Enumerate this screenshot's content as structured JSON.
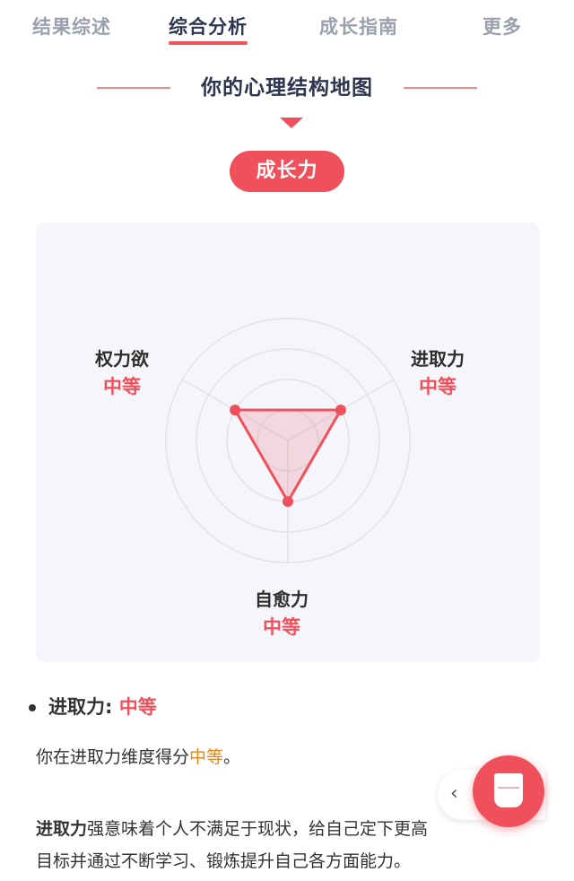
{
  "tabs": [
    {
      "label": "结果综述",
      "active": false
    },
    {
      "label": "综合分析",
      "active": true
    },
    {
      "label": "成长指南",
      "active": false
    },
    {
      "label": "更多",
      "active": false
    }
  ],
  "section": {
    "title": "你的心理结构地图",
    "pill": "成长力"
  },
  "radar": {
    "axes": [
      {
        "name": "权力欲",
        "level": "中等"
      },
      {
        "name": "进取力",
        "level": "中等"
      },
      {
        "name": "自愈力",
        "level": "中等"
      }
    ],
    "values": [
      0.5,
      0.5,
      0.5
    ]
  },
  "detail": {
    "bullet_label": "进取力:",
    "bullet_value": "中等",
    "line1_prefix": "你在进取力维度得分",
    "line1_value": "中等",
    "line1_suffix": "。",
    "line2_bold": "进取力",
    "line2_rest": "强意味着个人不满足于现状，给自己定下更高",
    "line3": "目标并通过不断学习、锻炼提升自己各方面能力。"
  },
  "colors": {
    "accent": "#f0505c",
    "title": "#2e3550",
    "card_bg": "#f5f6fa",
    "highlight": "#e0861a"
  },
  "icons": {
    "back": "chevron-left-icon",
    "fab": "report-cup-icon"
  }
}
